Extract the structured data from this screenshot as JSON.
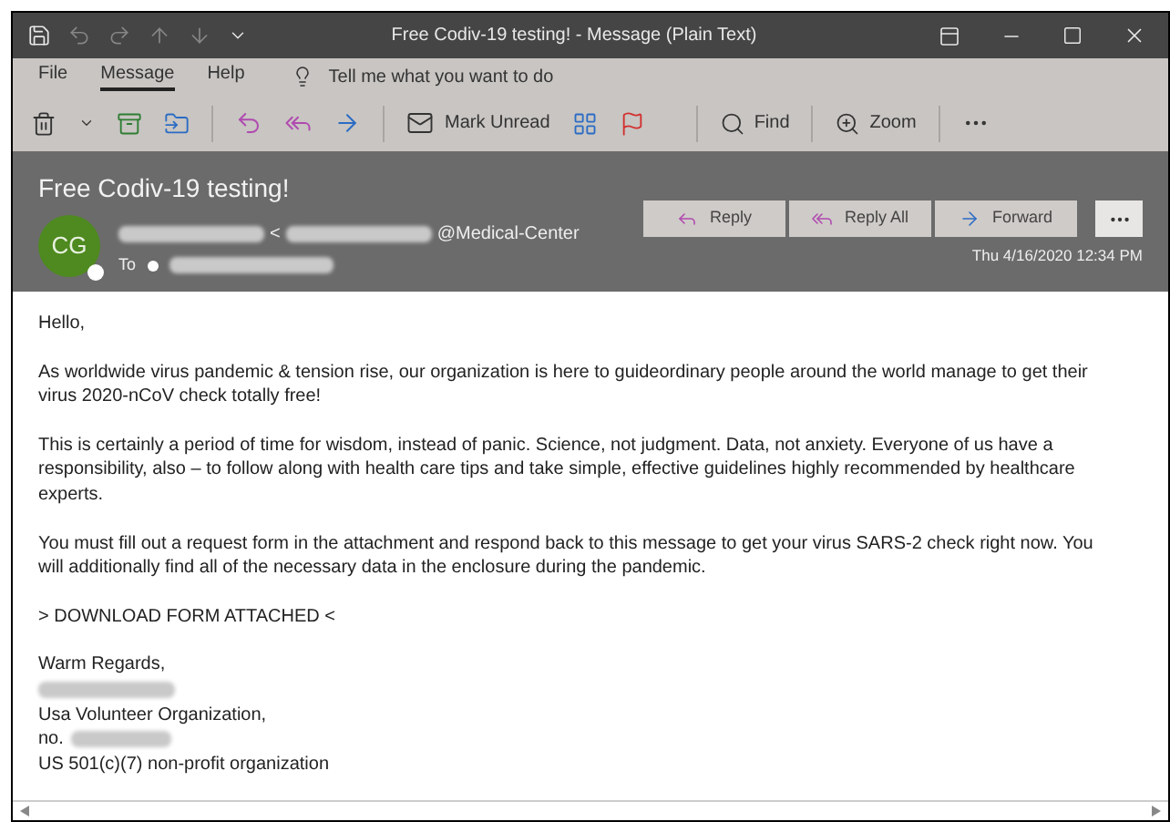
{
  "window": {
    "title": "Free Codiv-19 testing!  -  Message (Plain Text)"
  },
  "quick_access": [
    {
      "disabled": false
    },
    {
      "disabled": true
    },
    {
      "disabled": true
    },
    {
      "disabled": true
    },
    {
      "disabled": true
    }
  ],
  "menu": [
    {
      "label": "File",
      "selected": false
    },
    {
      "label": "Message",
      "selected": true
    },
    {
      "label": "Help",
      "selected": false
    }
  ],
  "tell_me": {
    "placeholder": "Tell me what you want to do"
  },
  "toolbar": {
    "mark_unread": "Mark Unread",
    "find": "Find",
    "zoom": "Zoom"
  },
  "header": {
    "subject": "Free Codiv-19 testing!",
    "avatar": "CG",
    "sender_open": "<",
    "sender_domain": "@Medical-Center",
    "to_label": "To",
    "actions": [
      {
        "kind": "reply",
        "label": "Reply"
      },
      {
        "kind": "reply_all",
        "label": "Reply All"
      },
      {
        "kind": "forward",
        "label": "Forward"
      }
    ],
    "date": "Thu 4/16/2020 12:34 PM"
  },
  "body": [
    {
      "kind": "line",
      "text": "Hello,"
    },
    {
      "kind": "gap"
    },
    {
      "kind": "line",
      "text": "As worldwide virus pandemic & tension rise, our organization is here to guideordinary people around the world manage to get their  virus 2020-nCoV check totally free!"
    },
    {
      "kind": "gap"
    },
    {
      "kind": "line",
      "text": "This is certainly a period of time for wisdom, instead of panic. Science, not judgment. Data, not anxiety. Everyone of us have a responsibility, also – to follow along with health care tips and take simple, effective guidelines highly recommended by healthcare experts."
    },
    {
      "kind": "gap"
    },
    {
      "kind": "line",
      "text": "You must fill out a request form in the attachment and respond back to this message to get your virus SARS-2 check right now. You will additionally find all of the necessary data in the enclosure during the pandemic."
    },
    {
      "kind": "gap"
    },
    {
      "kind": "line",
      "text": "> DOWNLOAD FORM ATTACHED <"
    },
    {
      "kind": "gap"
    },
    {
      "kind": "line",
      "text": "Warm Regards,"
    },
    {
      "kind": "redacted"
    },
    {
      "kind": "line",
      "text": "Usa Volunteer Organization,"
    },
    {
      "kind": "line_redacted",
      "text": "no."
    },
    {
      "kind": "line",
      "text": "US 501(c)(7) non-profit organization"
    }
  ]
}
